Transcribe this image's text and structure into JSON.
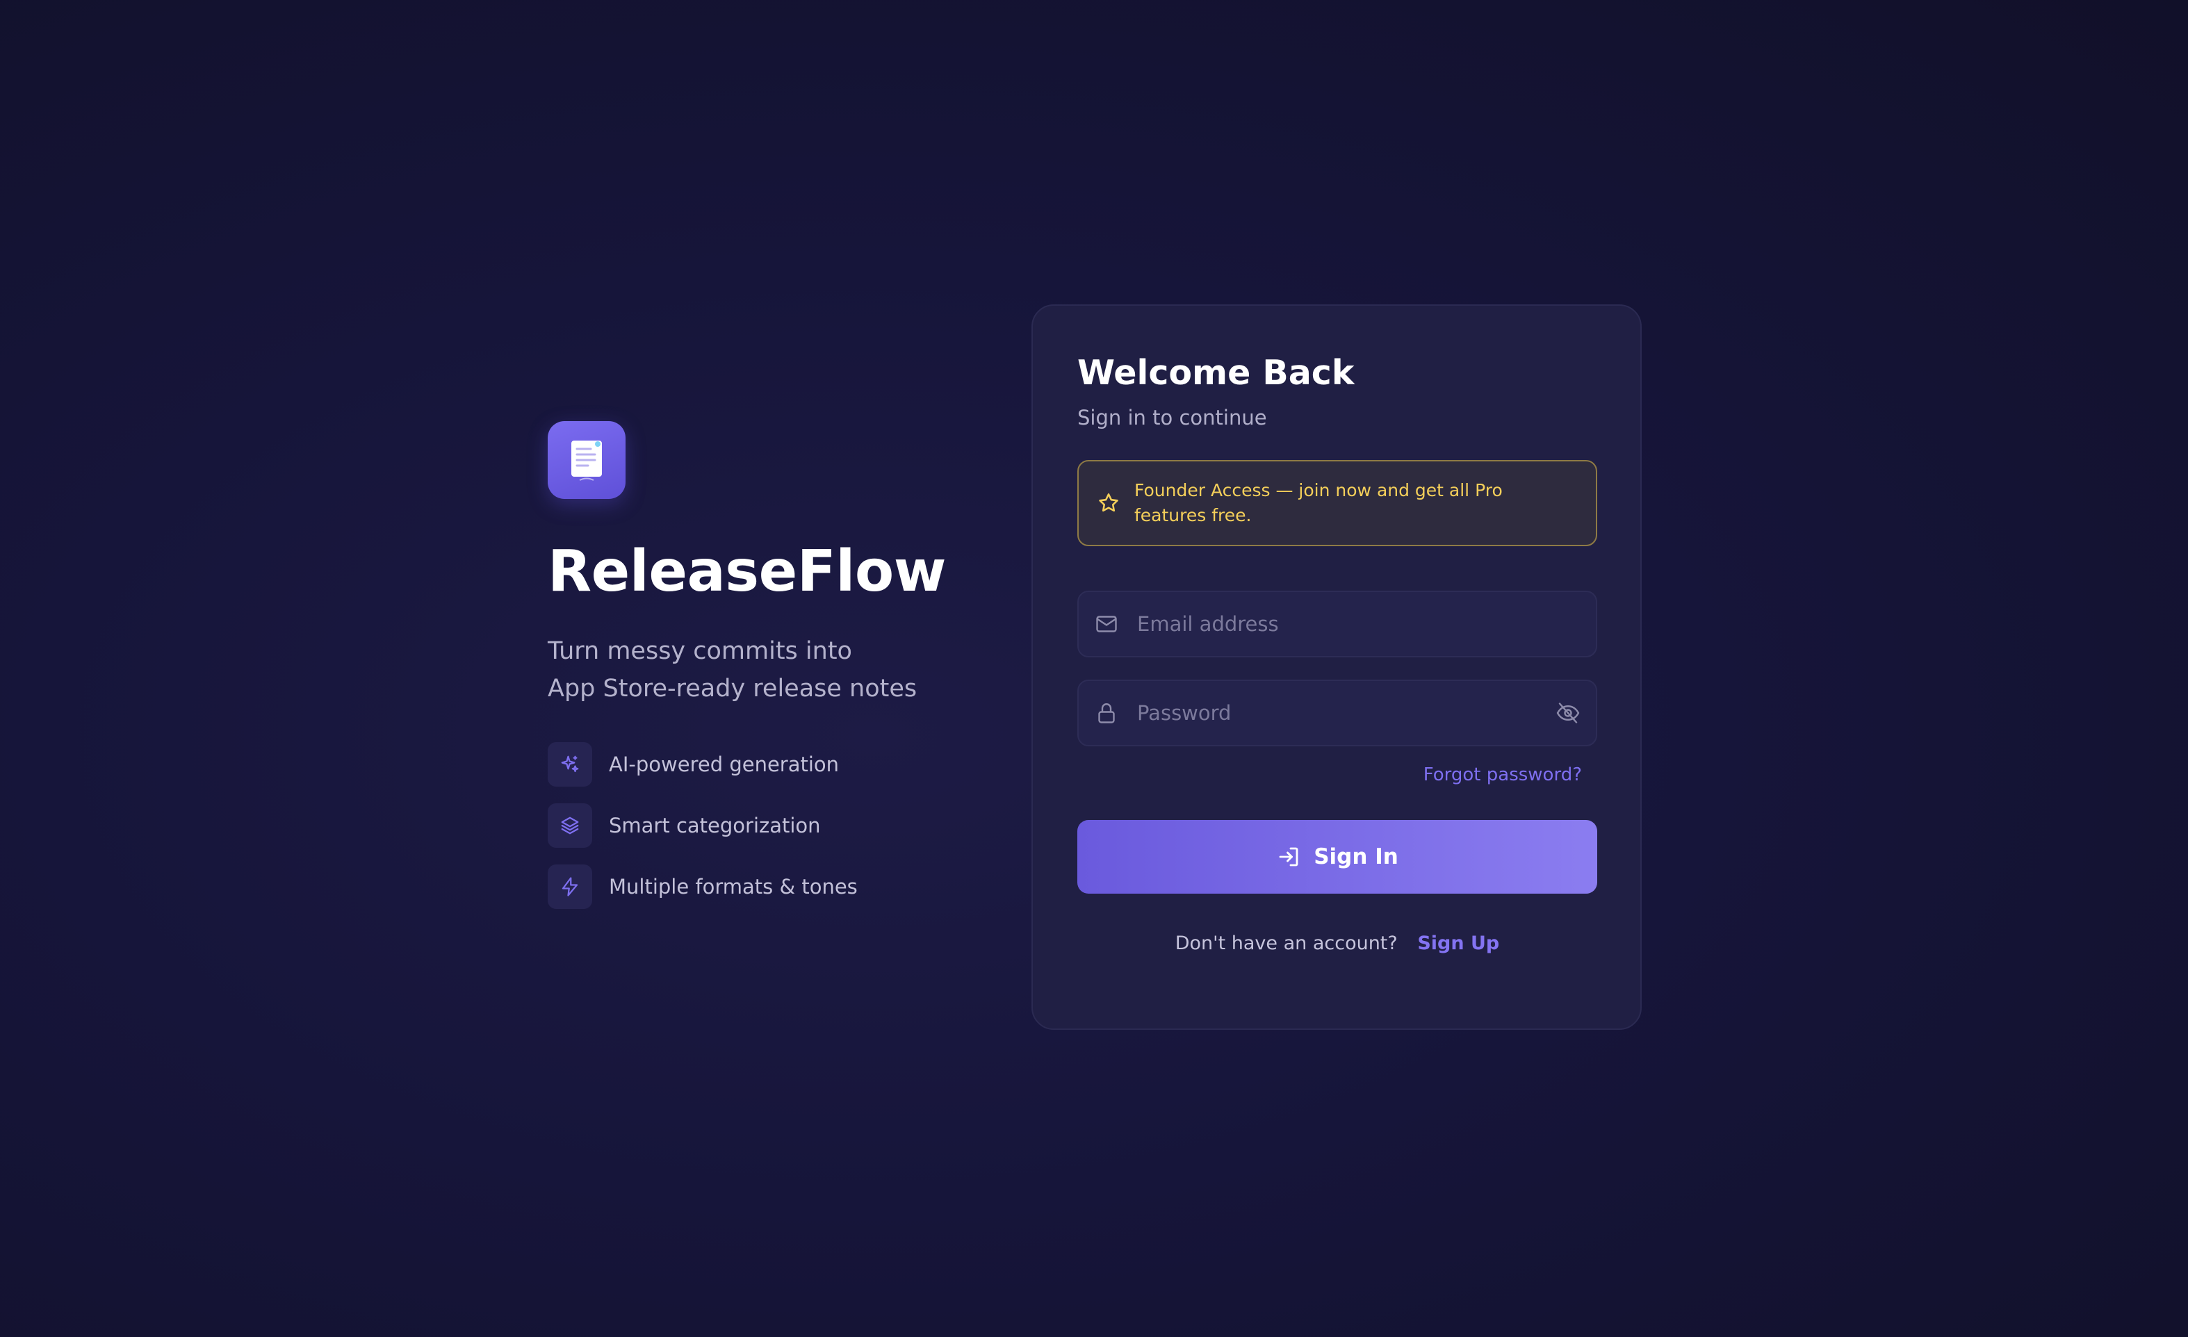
{
  "brand": {
    "icon": "document-icon",
    "title": "ReleaseFlow",
    "tagline_line1": "Turn messy commits into",
    "tagline_line2": "App Store-ready release notes",
    "features": [
      {
        "icon": "sparkles-icon",
        "label": "AI-powered generation"
      },
      {
        "icon": "layers-icon",
        "label": "Smart categorization"
      },
      {
        "icon": "lightning-icon",
        "label": "Multiple formats & tones"
      }
    ]
  },
  "signin": {
    "title": "Welcome Back",
    "subtitle": "Sign in to continue",
    "banner": {
      "icon": "star-icon",
      "text": "Founder Access — join now and get all Pro features free."
    },
    "email": {
      "icon": "mail-icon",
      "placeholder": "Email address",
      "value": ""
    },
    "password": {
      "icon": "lock-icon",
      "placeholder": "Password",
      "value": "",
      "toggle_icon": "eye-off-icon"
    },
    "forgot_label": "Forgot password?",
    "button": {
      "icon": "log-in-icon",
      "label": "Sign In"
    },
    "signup_prompt": "Don't have an account?",
    "signup_link": "Sign Up"
  },
  "colors": {
    "accent": "#6a5add",
    "accent_light": "#8b7df0",
    "banner_text": "#f4cf5a",
    "banner_border": "#8e7a45",
    "card_bg": "#201f44",
    "page_bg": "#16153a"
  }
}
